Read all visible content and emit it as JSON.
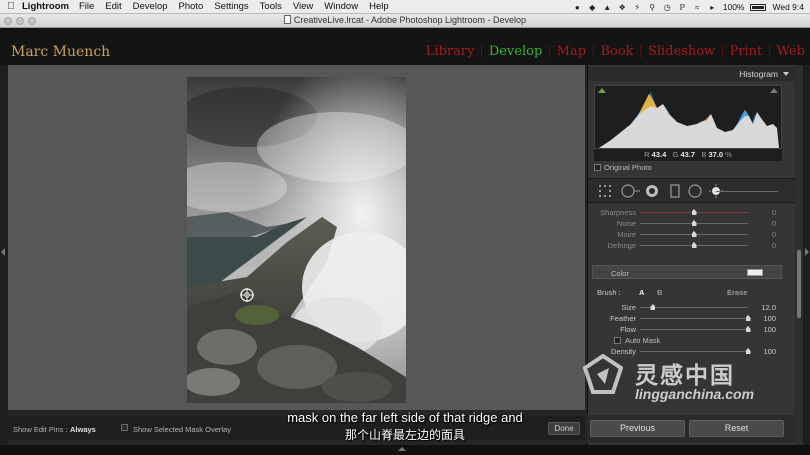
{
  "menubar": {
    "app_name": "Lightroom",
    "items": [
      "File",
      "Edit",
      "Develop",
      "Photo",
      "Settings",
      "Tools",
      "View",
      "Window",
      "Help"
    ],
    "battery": "100%",
    "clock": "Wed 9:4"
  },
  "window": {
    "title": "CreativeLive.lrcat - Adobe Photoshop Lightroom - Develop"
  },
  "identity_plate": "Marc Muench",
  "modules": [
    {
      "label": "Library",
      "active": false
    },
    {
      "label": "Develop",
      "active": true
    },
    {
      "label": "Map",
      "active": false
    },
    {
      "label": "Book",
      "active": false
    },
    {
      "label": "Slideshow",
      "active": false
    },
    {
      "label": "Print",
      "active": false
    },
    {
      "label": "Web",
      "active": false
    }
  ],
  "toolbar": {
    "edit_pins_label": "Show Edit Pins :",
    "edit_pins_value": "Always",
    "mask_overlay_label": "Show Selected Mask Overlay",
    "done_label": "Done"
  },
  "panel": {
    "histogram_title": "Histogram",
    "rgb": {
      "r_label": "R",
      "r": "43.4",
      "g_label": "G",
      "g": "43.7",
      "b_label": "B",
      "b": "37.0",
      "unit": "%"
    },
    "original_photo_label": "Original Photo",
    "detail_sliders": [
      {
        "name": "Sharpness",
        "value": "0",
        "fraction": 0.5
      },
      {
        "name": "Noise",
        "value": "0",
        "fraction": 0.5
      },
      {
        "name": "Moire",
        "value": "0",
        "fraction": 0.5
      },
      {
        "name": "Defringe",
        "value": "0",
        "fraction": 0.5
      }
    ],
    "color_label": "Color",
    "brush": {
      "label": "Brush :",
      "a": "A",
      "b": "B",
      "erase": "Erase"
    },
    "brush_sliders": [
      {
        "name": "Size",
        "value": "12.0",
        "fraction": 0.12
      },
      {
        "name": "Feather",
        "value": "100",
        "fraction": 1.0
      },
      {
        "name": "Flow",
        "value": "100",
        "fraction": 1.0
      }
    ],
    "auto_mask_label": "Auto Mask",
    "density": {
      "name": "Density",
      "value": "100",
      "fraction": 1.0
    },
    "previous_label": "Previous",
    "reset_label": "Reset"
  },
  "subtitles": {
    "en": "mask on the far left side of that ridge and",
    "zh": "那个山脊最左边的面具"
  },
  "watermark": {
    "cn": "灵感中国",
    "en": "lingganchina.com"
  },
  "colors": {
    "module_active": "#35b538",
    "module_inactive": "#a31c1c",
    "identity": "#c9a25b",
    "histogram_clip": "#6ba35b"
  }
}
